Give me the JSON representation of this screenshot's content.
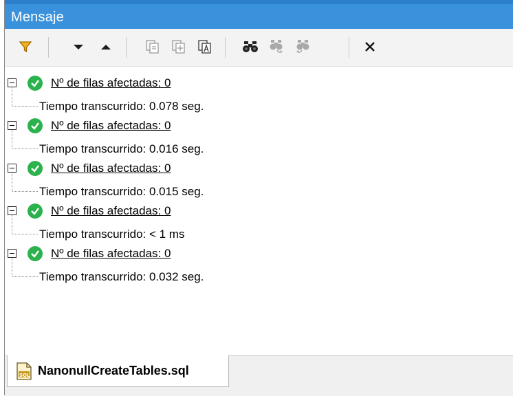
{
  "window": {
    "title": "Mensaje"
  },
  "toolbar": {
    "icons": [
      "filter-icon",
      "next-down-icon",
      "previous-up-icon",
      "copy-selected-icon",
      "copy-with-children-icon",
      "copy-all-icon",
      "find-icon",
      "find-next-icon",
      "find-previous-icon",
      "clear-icon"
    ]
  },
  "messages": [
    {
      "summary": "Nº de filas afectadas: 0",
      "detail": "Tiempo transcurrido: 0.078 seg."
    },
    {
      "summary": "Nº de filas afectadas: 0",
      "detail": "Tiempo transcurrido: 0.016 seg."
    },
    {
      "summary": "Nº de filas afectadas: 0",
      "detail": "Tiempo transcurrido: 0.015 seg."
    },
    {
      "summary": "Nº de filas afectadas: 0",
      "detail": "Tiempo transcurrido: < 1 ms"
    },
    {
      "summary": "Nº de filas afectadas: 0",
      "detail": "Tiempo transcurrido: 0.032 seg."
    }
  ],
  "tabs": [
    {
      "label": "NanonullCreateTables.sql",
      "icon": "sql-file-icon"
    }
  ],
  "colors": {
    "titlebar": "#3a92dc",
    "success": "#2bb24c",
    "filter": "#e8a200"
  }
}
